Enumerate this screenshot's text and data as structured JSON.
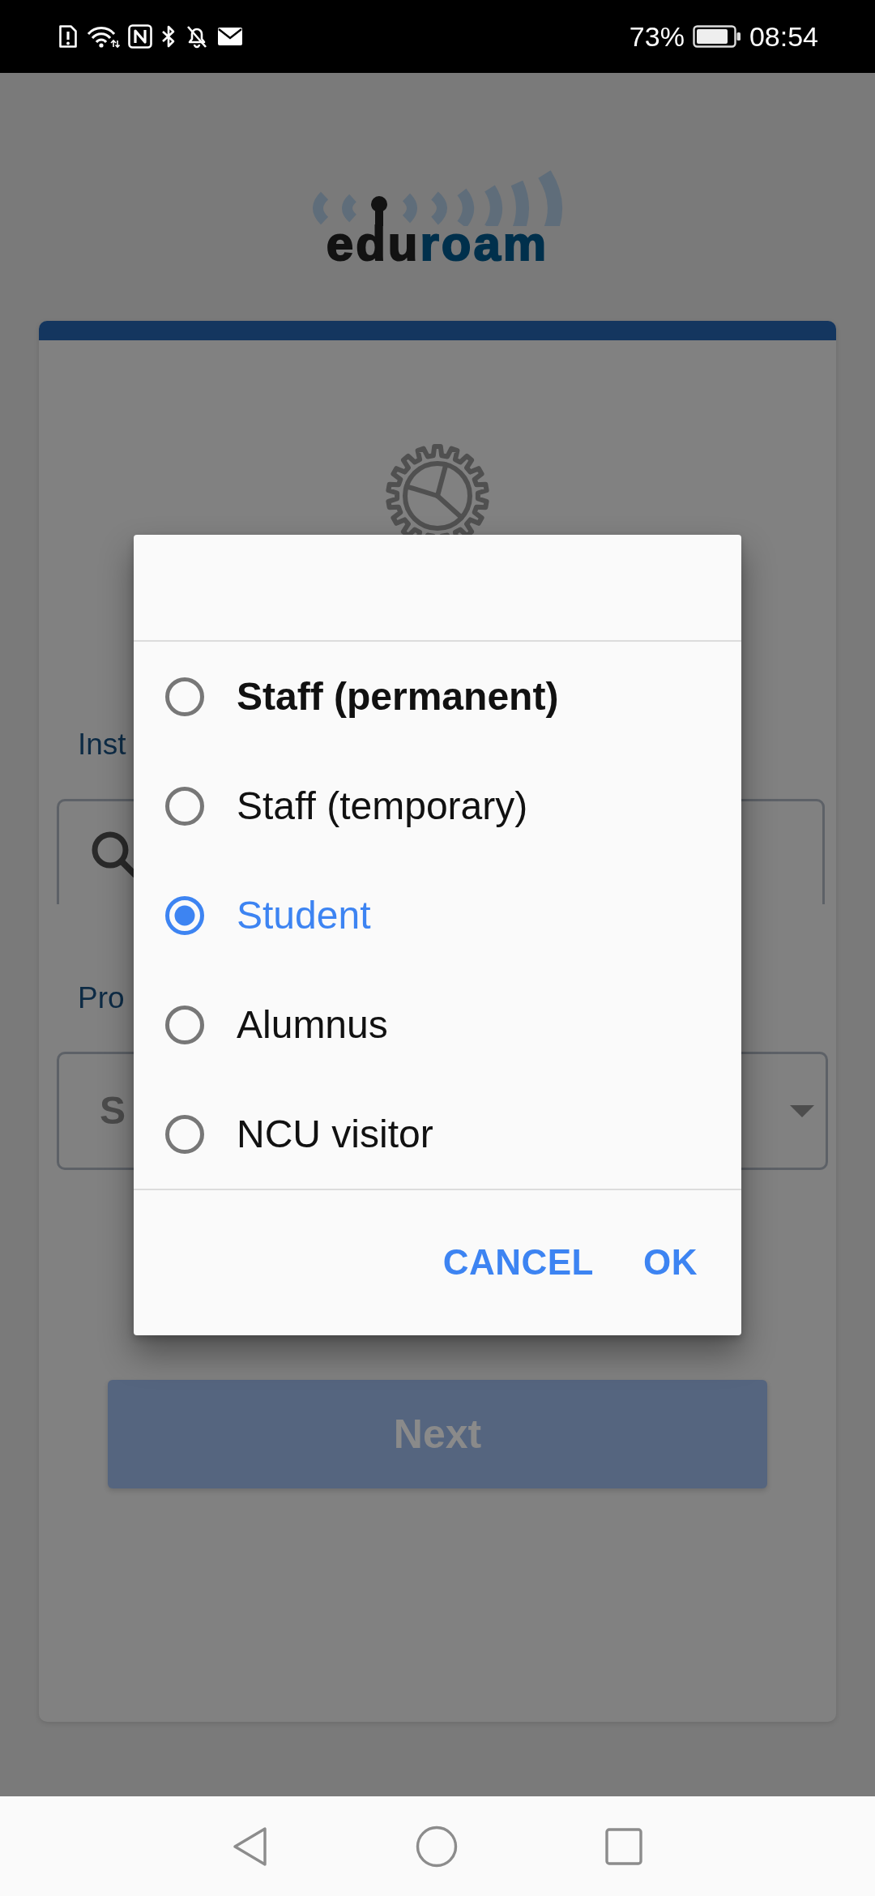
{
  "status_bar": {
    "battery_percent": "73%",
    "time": "08:54"
  },
  "logo": {
    "text_dark": "edu",
    "text_accent": "roam"
  },
  "form": {
    "institution": {
      "label": "Inst"
    },
    "profile": {
      "label": "Pro",
      "value": "S"
    },
    "next_button": {
      "label": "Next",
      "disabled": true
    }
  },
  "dialog": {
    "options": [
      {
        "label": "Staff (permanent)",
        "selected": false,
        "emphasized": true
      },
      {
        "label": "Staff (temporary)",
        "selected": false,
        "emphasized": false
      },
      {
        "label": "Student",
        "selected": true,
        "emphasized": false
      },
      {
        "label": "Alumnus",
        "selected": false,
        "emphasized": false
      },
      {
        "label": "NCU visitor",
        "selected": false,
        "emphasized": false
      }
    ],
    "buttons": [
      "CANCEL",
      "OK"
    ]
  }
}
